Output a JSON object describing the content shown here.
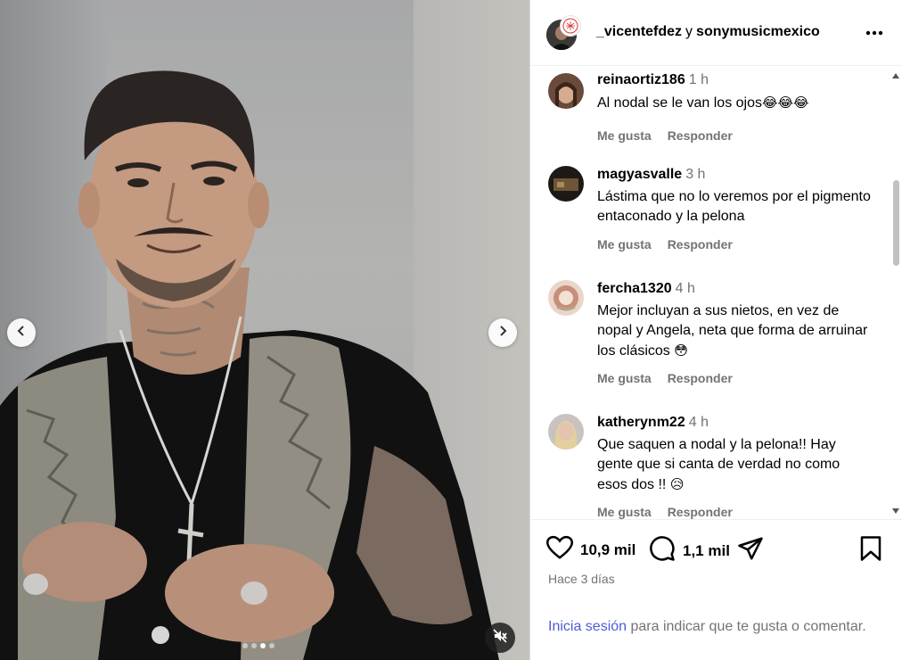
{
  "header": {
    "user1": "_vicentefdez",
    "connector": "y",
    "user2": "sonymusicmexico"
  },
  "comments": [
    {
      "user": "reinaortiz186",
      "time": "1 h",
      "text": "Al nodal se le van los ojos",
      "emoji": "😂😂😂",
      "like": "Me gusta",
      "reply": "Responder"
    },
    {
      "user": "magyasvalle",
      "time": "3 h",
      "text": "Lástima que no lo veremos por el pigmento entaconado y la pelona",
      "emoji": "",
      "like": "Me gusta",
      "reply": "Responder"
    },
    {
      "user": "fercha1320",
      "time": "4 h",
      "text": "Mejor incluyan a sus nietos, en vez de nopal y Angela, neta que forma de arruinar los clásicos",
      "emoji": "😳",
      "like": "Me gusta",
      "reply": "Responder"
    },
    {
      "user": "katherynm22",
      "time": "4 h",
      "text": "Que saquen a nodal y la pelona!! Hay gente que si canta de verdad no como esos dos !!",
      "emoji": "😥",
      "like": "Me gusta",
      "reply": "Responder"
    }
  ],
  "stats": {
    "likes": "10,9 mil",
    "comments": "1,1 mil"
  },
  "posted": "Hace 3 días",
  "login": {
    "link": "Inicia sesión",
    "rest": " para indicar que te gusta o comentar."
  },
  "media": {
    "slide_count": 4,
    "active_slide": 3
  },
  "icons": {
    "prev": "chevron-left-icon",
    "next": "chevron-right-icon",
    "mute": "speaker-muted-icon",
    "more": "more-horizontal-icon",
    "like": "heart-icon",
    "comment": "comment-bubble-icon",
    "share": "paper-plane-icon",
    "save": "bookmark-icon"
  },
  "colors": {
    "link": "#4f5bd5",
    "secondary": "#737373",
    "border": "#dbdbdb"
  }
}
